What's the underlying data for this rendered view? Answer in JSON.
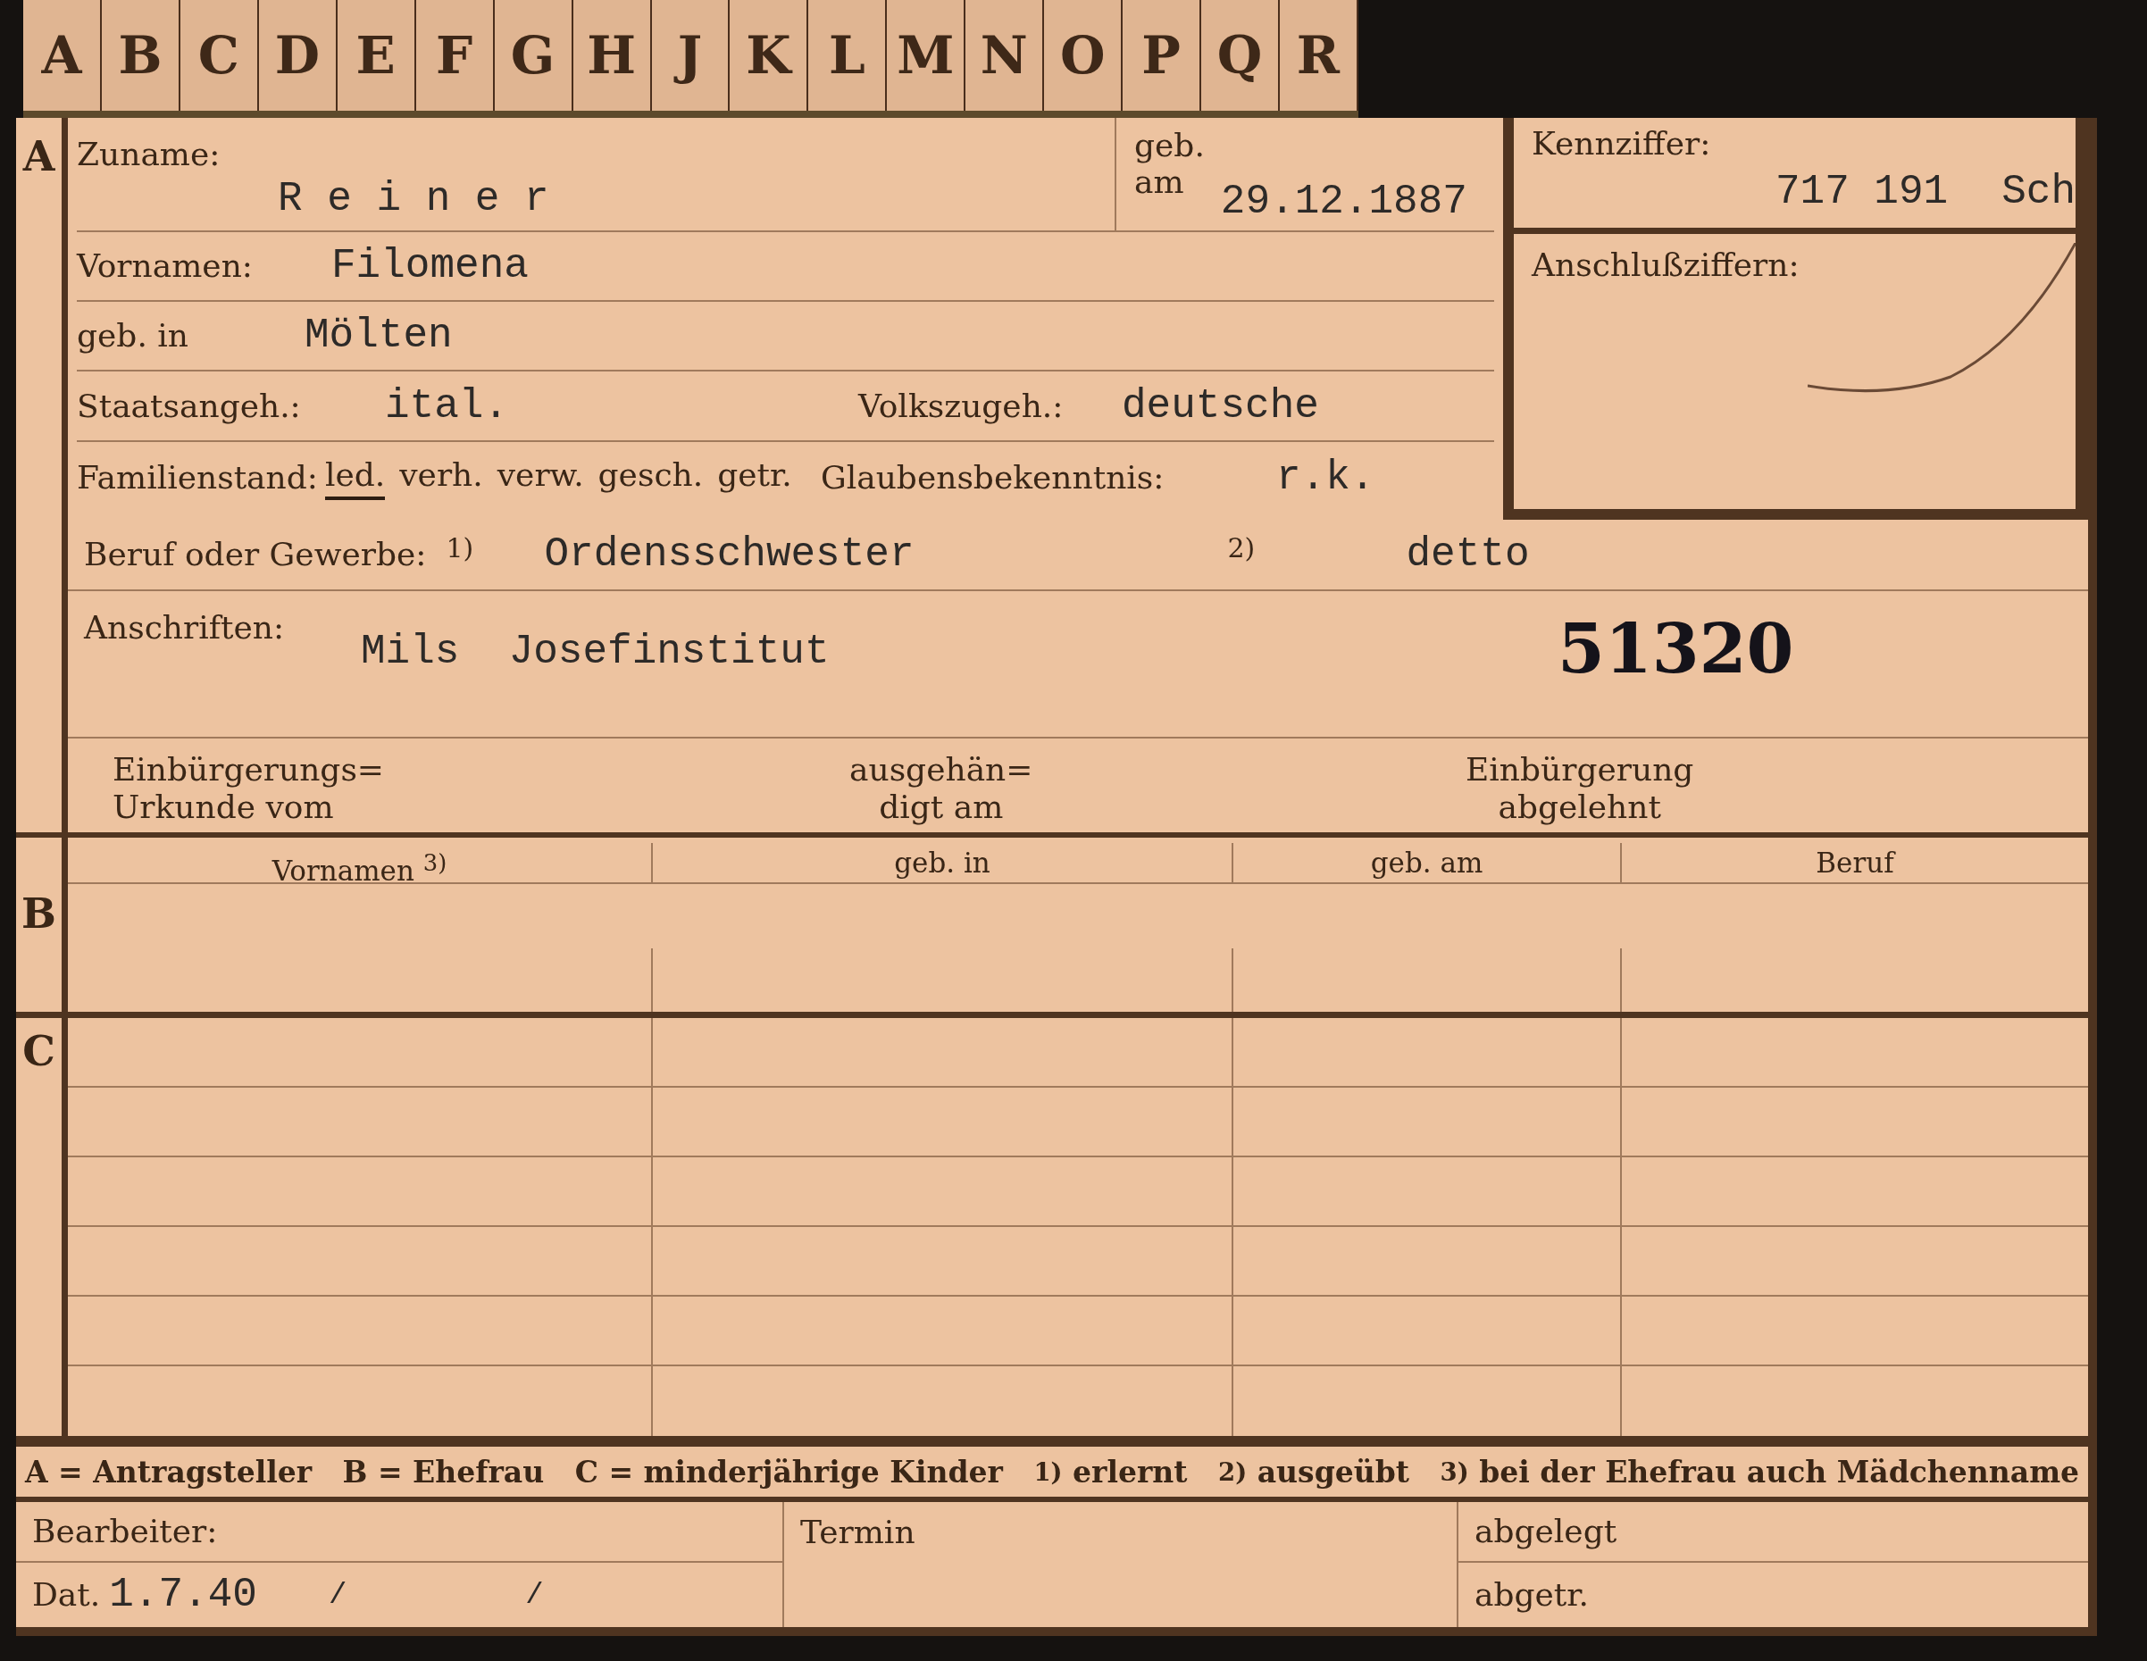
{
  "index_tabs": [
    "A",
    "B",
    "C",
    "D",
    "E",
    "F",
    "G",
    "H",
    "J",
    "K",
    "L",
    "M",
    "N",
    "O",
    "P",
    "Q",
    "R"
  ],
  "section_a": {
    "letter": "A",
    "surname": {
      "label": "Zuname:",
      "value": "R e i n e r"
    },
    "birth_date": {
      "label_top": "geb.",
      "label_bottom": "am",
      "value": "29.12.1887"
    },
    "reference": {
      "label": "Kennziffer:",
      "value": "717 191",
      "suffix": "Sch"
    },
    "linked_numbers": {
      "label": "Anschlußziffern:"
    },
    "first_names": {
      "label": "Vornamen:",
      "value": "Filomena"
    },
    "birthplace": {
      "label": "geb. in",
      "value": "Mölten"
    },
    "citizenship": {
      "label": "Staatsangeh.:",
      "value": "ital."
    },
    "ethnicity": {
      "label": "Volkszugeh.:",
      "value": "deutsche"
    },
    "marital_status": {
      "label": "Familienstand:",
      "options": [
        {
          "label": "led.",
          "selected": true
        },
        {
          "label": "verh.",
          "selected": false
        },
        {
          "label": "verw.",
          "selected": false
        },
        {
          "label": "gesch.",
          "selected": false
        },
        {
          "label": "getr.",
          "selected": false
        }
      ]
    },
    "religion": {
      "label": "Glaubensbekenntnis:",
      "value": "r.k."
    },
    "occupation": {
      "label": "Beruf oder Gewerbe:",
      "note_1": "$^{1)}$",
      "value_1": "Ordensschwester",
      "note_2": "$^{2)}$",
      "value_2": "detto"
    },
    "address": {
      "label": "Anschriften:",
      "value": "Mils  Josefinstitut",
      "stamp": "51320"
    },
    "naturalization": [
      "Einbürgerungs=\nUrkunde vom",
      "ausgehän=\ndigt am",
      "Einbürgerung\nabgelehnt"
    ]
  },
  "section_b": {
    "letter": "B",
    "columns": [
      "Vornamen $^{3)}$",
      "geb. in",
      "geb. am",
      "Beruf"
    ]
  },
  "section_c": {
    "letter": "C"
  },
  "legend": "A = Antragsteller   B = Ehefrau   C = minderjährige Kinder   $^{1)}$ erlernt   $^{2)}$ ausgeübt   $^{3)}$ bei der Ehefrau auch Mädchenname",
  "footer": {
    "clerk_label": "Bearbeiter:",
    "date_label": "Dat.",
    "date_value": "1.7.40",
    "separators": [
      "/",
      "/"
    ],
    "deadline_label": "Termin",
    "filed_label": "abgelegt",
    "removed_label": "abgetr."
  }
}
